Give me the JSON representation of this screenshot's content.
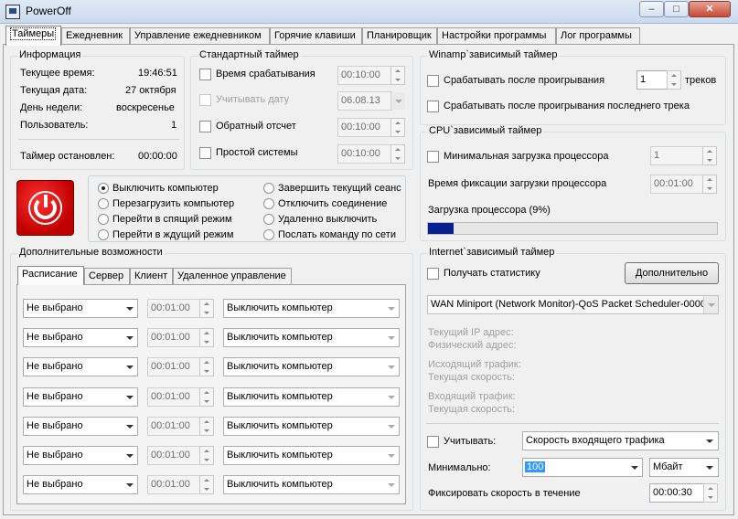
{
  "window": {
    "title": "PowerOff",
    "minimize": "–",
    "maximize": "□",
    "close": "✕"
  },
  "tabs": [
    "Таймеры",
    "Ежедневник",
    "Управление ежедневником",
    "Горячие клавиши",
    "Планировщик",
    "Настройки программы",
    "Лог программы"
  ],
  "info": {
    "title": "Информация",
    "time_label": "Текущее время:",
    "time": "19:46:51",
    "date_label": "Текущая дата:",
    "date": "27 октября",
    "day_label": "День недели:",
    "day": "воскресенье",
    "user_label": "Пользователь:",
    "user": "1",
    "timer_label": "Таймер остановлен:",
    "timer": "00:00:00"
  },
  "std": {
    "title": "Стандартный таймер",
    "r1": "Время срабатывания",
    "v1": "00:10:00",
    "r2": "Учитывать дату",
    "v2": "06.08.13",
    "r3": "Обратный отсчет",
    "v3": "00:10:00",
    "r4": "Простой системы",
    "v4": "00:10:00"
  },
  "winamp": {
    "title": "Winamp`зависимый таймер",
    "r1": "Срабатывать после проигрывания",
    "count": "1",
    "unit": "треков",
    "r2": "Срабатывать после проигрывания последнего трека"
  },
  "cpu": {
    "title": "CPU`зависимый таймер",
    "r1": "Минимальная загрузка процессора",
    "v1": "1",
    "r2": "Время фиксации загрузки процессора",
    "v2": "00:01:00",
    "load_label": "Загрузка процессора (9%)",
    "load": 0.09
  },
  "actions": [
    "Выключить компьютер",
    "Перезагрузить компьютер",
    "Перейти в спящий режим",
    "Перейти в ждущий режим",
    "Завершить текущий сеанс",
    "Отключить соединение",
    "Удаленно выключить",
    "Послать команду по сети"
  ],
  "extra": {
    "title": "Дополнительные возможности",
    "tabs": [
      "Расписание",
      "Сервер",
      "Клиент",
      "Удаленное управление"
    ],
    "rows": [
      {
        "sel": "Не выбрано",
        "time": "00:01:00",
        "action": "Выключить компьютер"
      },
      {
        "sel": "Не выбрано",
        "time": "00:01:00",
        "action": "Выключить компьютер"
      },
      {
        "sel": "Не выбрано",
        "time": "00:01:00",
        "action": "Выключить компьютер"
      },
      {
        "sel": "Не выбрано",
        "time": "00:01:00",
        "action": "Выключить компьютер"
      },
      {
        "sel": "Не выбрано",
        "time": "00:01:00",
        "action": "Выключить компьютер"
      },
      {
        "sel": "Не выбрано",
        "time": "00:01:00",
        "action": "Выключить компьютер"
      },
      {
        "sel": "Не выбрано",
        "time": "00:01:00",
        "action": "Выключить компьютер"
      }
    ]
  },
  "inet": {
    "title": "Internet`зависимый таймер",
    "stat": "Получать статистику",
    "more": "Дополнительно",
    "adapter": "WAN Miniport (Network Monitor)-QoS Packet Scheduler-0000",
    "ip": "Текущий IP адрес:",
    "phys": "Физический адрес:",
    "out": "Исходящий трафик:",
    "out_speed": "Текущая скорость:",
    "in": "Входящий трафик:",
    "in_speed": "Текущая скорость:",
    "count_label": "Учитывать:",
    "speed_type": "Скорость входящего трафика",
    "min_label": "Минимально:",
    "min_value": "100",
    "unit": "Мбайт",
    "fix_label": "Фиксировать скорость в течение",
    "fix_value": "00:00:30"
  },
  "icons": {
    "app": "app-icon",
    "power": "power-icon"
  },
  "colors": {
    "power_red": "#d40000",
    "progress": "#0a1f8f",
    "selection": "#3399ff"
  }
}
